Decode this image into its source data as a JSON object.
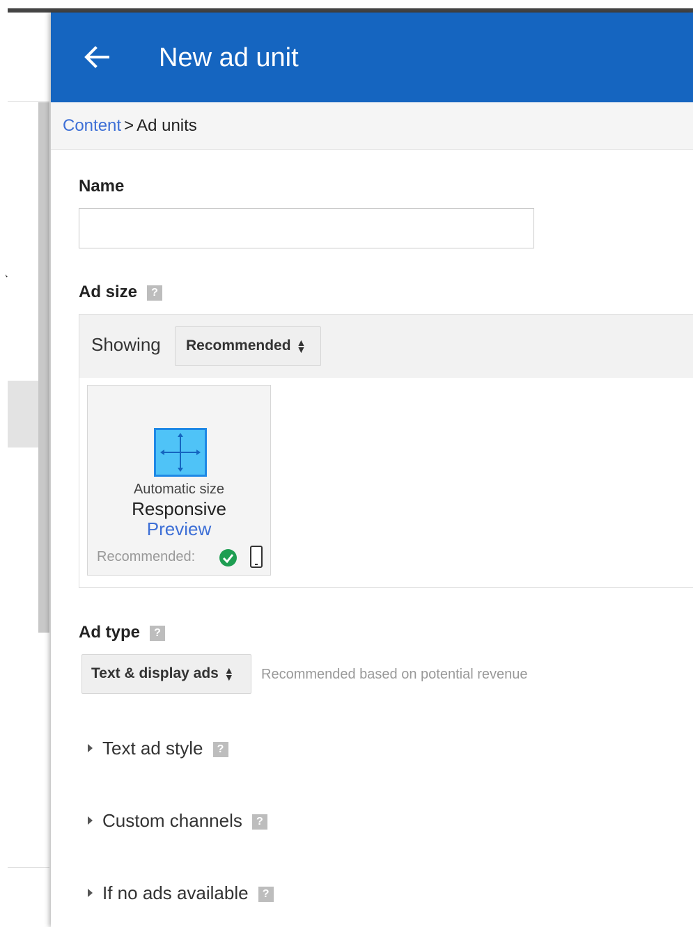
{
  "header": {
    "title": "New ad unit"
  },
  "breadcrumb": {
    "link": "Content",
    "separator": ">",
    "current": "Ad units"
  },
  "name_field": {
    "label": "Name",
    "value": "",
    "placeholder": ""
  },
  "ad_size": {
    "label": "Ad size",
    "help_glyph": "?",
    "showing_label": "Showing",
    "filter_value": "Recommended",
    "card": {
      "caption": "Automatic size",
      "title": "Responsive",
      "preview_link": "Preview",
      "recommended_label": "Recommended:",
      "icons": [
        "check-circle-icon",
        "mobile-phone-icon"
      ]
    }
  },
  "ad_type": {
    "label": "Ad type",
    "help_glyph": "?",
    "value": "Text & display ads",
    "hint": "Recommended based on potential revenue"
  },
  "sections": [
    {
      "label": "Text ad style"
    },
    {
      "label": "Custom channels"
    },
    {
      "label": "If no ads available"
    }
  ],
  "colors": {
    "header_bg": "#1565c0",
    "link": "#3d6fd6",
    "responsive_icon": "#4fc3f7",
    "check_green": "#1e9e52"
  }
}
